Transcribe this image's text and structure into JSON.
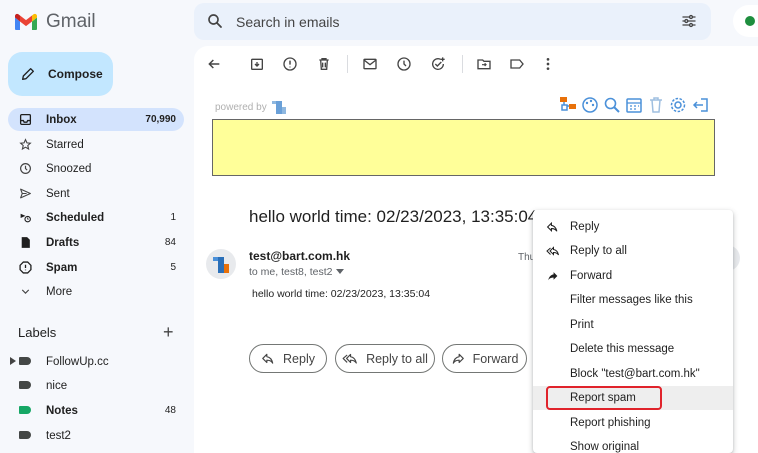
{
  "app": {
    "name": "Gmail"
  },
  "search": {
    "placeholder": "Search in emails"
  },
  "compose": {
    "label": "Compose"
  },
  "nav": [
    {
      "label": "Inbox",
      "count": "70,990",
      "icon": "inbox-icon"
    },
    {
      "label": "Starred",
      "count": "",
      "icon": "star-icon"
    },
    {
      "label": "Snoozed",
      "count": "",
      "icon": "clock-icon"
    },
    {
      "label": "Sent",
      "count": "",
      "icon": "send-icon"
    },
    {
      "label": "Scheduled",
      "count": "1",
      "icon": "scheduled-icon"
    },
    {
      "label": "Drafts",
      "count": "84",
      "icon": "draft-icon"
    },
    {
      "label": "Spam",
      "count": "5",
      "icon": "spam-icon"
    },
    {
      "label": "More",
      "count": "",
      "icon": "chevron-down-icon"
    }
  ],
  "labels": {
    "heading": "Labels",
    "add_symbol": "+",
    "items": [
      {
        "label": "FollowUp.cc",
        "count": "",
        "color": "#444746"
      },
      {
        "label": "nice",
        "count": "",
        "color": "#444746"
      },
      {
        "label": "Notes",
        "count": "48",
        "color": "#16a765"
      },
      {
        "label": "test2",
        "count": "",
        "color": "#444746"
      }
    ]
  },
  "extension": {
    "powered_by": "powered by"
  },
  "email": {
    "subject": "hello world time: 02/23/2023, 13:35:04",
    "sender": "test@bart.com.hk",
    "recipients": "to me, test8, test2",
    "date_partial": "Thu",
    "body": "hello world time: 02/23/2023, 13:35:04"
  },
  "reply_buttons": {
    "reply": "Reply",
    "reply_all": "Reply to all",
    "forward": "Forward"
  },
  "menu": {
    "items": [
      {
        "label": "Reply",
        "icon": "reply-icon"
      },
      {
        "label": "Reply to all",
        "icon": "reply-all-icon"
      },
      {
        "label": "Forward",
        "icon": "forward-icon"
      },
      {
        "label": "Filter messages like this",
        "icon": ""
      },
      {
        "label": "Print",
        "icon": ""
      },
      {
        "label": "Delete this message",
        "icon": ""
      },
      {
        "label": "Block \"test@bart.com.hk\"",
        "icon": ""
      },
      {
        "label": "Report spam",
        "icon": ""
      },
      {
        "label": "Report phishing",
        "icon": ""
      },
      {
        "label": "Show original",
        "icon": ""
      }
    ],
    "highlighted": "Report spam"
  },
  "colors": {
    "accent": "#c2e7ff",
    "active_nav": "#d3e3fd",
    "highlight_border": "#e0232b"
  }
}
